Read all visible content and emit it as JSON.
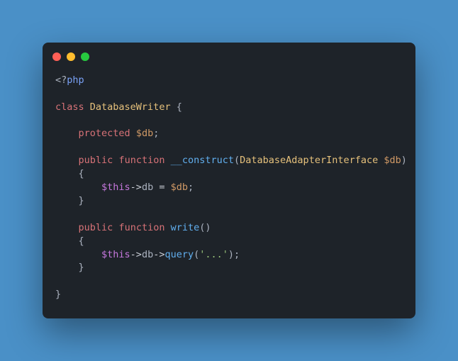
{
  "dots": {
    "red": "#ff5f56",
    "yellow": "#ffbd2e",
    "green": "#27c93f"
  },
  "code": {
    "open_tag_lt": "<?",
    "open_tag_php": "php",
    "kw_class": "class",
    "cls_name": "DatabaseWriter",
    "brace_open": " {",
    "kw_protected": "protected",
    "var_db": "$db",
    "semi": ";",
    "kw_public": "public",
    "kw_function": "function",
    "fn_construct": "__construct",
    "paren_open": "(",
    "cls_iface": "DatabaseAdapterInterface",
    "param_db": "$db",
    "paren_close": ")",
    "brace_l": "{",
    "this": "$this",
    "arrow": "->",
    "prop_db": "db",
    "eq": " = ",
    "var_db2": "$db",
    "brace_r": "}",
    "fn_write": "write",
    "empty_parens": "()",
    "prop_db2": "db",
    "fn_query": "query",
    "str_dots": "'...'",
    "close_paren_semi": ");",
    "class_close": "}"
  }
}
